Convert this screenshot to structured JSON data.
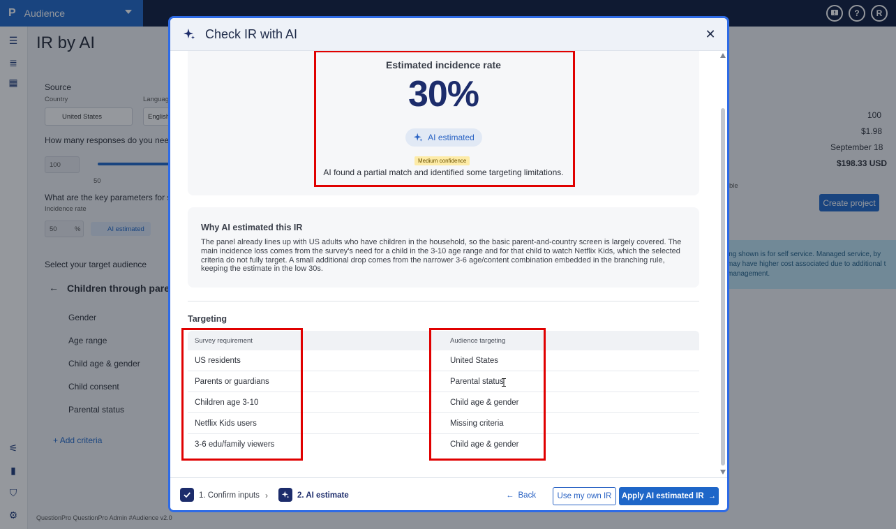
{
  "topbar": {
    "app_logo": "P",
    "app_name": "Audience",
    "icons": [
      "feedback-icon",
      "help-icon"
    ],
    "user_initial": "R"
  },
  "sidenav": {
    "icons": [
      "menu-icon",
      "list-icon",
      "dashboard-icon",
      "settings-sliders-icon",
      "trash-icon",
      "shield-user-icon",
      "gear-icon"
    ]
  },
  "background_page": {
    "title": "IR by AI",
    "source_label": "Source",
    "country_label": "Country",
    "country_value": "United States",
    "language_label": "Languag",
    "language_value": "English",
    "responses_question": "How many responses do you need?",
    "responses_value": "100",
    "slider_min": "50",
    "key_params_question": "What are the key parameters for su",
    "incidence_rate_label": "Incidence rate",
    "incidence_rate_value": "50",
    "percent_sign": "%",
    "ai_estimated_tag": "AI estimated",
    "audience_label": "Select your target audience",
    "audience_title": "Children through pare",
    "criteria": [
      "Gender",
      "Age range",
      "Child age & gender",
      "Child consent",
      "Parental status"
    ],
    "add_criteria": "Add criteria",
    "summary_values": [
      "100",
      "$1.98",
      "September 18",
      "$198.33 USD"
    ],
    "summary_fragment": "ble",
    "create_project": "Create project",
    "info_banner": "ing shown is for self service. Managed service, by may have higher cost associated due to additional t management.",
    "footer_note": "QuestionPro QuestionPro Admin  #Audience v2.0"
  },
  "modal": {
    "title": "Check IR with AI",
    "estimate": {
      "label": "Estimated incidence rate",
      "value": "30%",
      "pill": "AI estimated",
      "confidence": "Medium confidence",
      "note": "AI found a partial match and identified some targeting limitations."
    },
    "why": {
      "title": "Why AI estimated this IR",
      "text": "The panel already lines up with US adults who have children in the household, so the basic parent-and-country screen is largely covered. The main incidence loss comes from the survey's need for a child in the 3-10 age range and for that child to watch Netflix Kids, which the selected criteria do not fully target. A small additional drop comes from the narrower 3-6 age/content combination embedded in the branching rule, keeping the estimate in the low 30s."
    },
    "targeting": {
      "title": "Targeting",
      "columns": [
        "Survey requirement",
        "Audience targeting"
      ],
      "rows": [
        [
          "US residents",
          "United States"
        ],
        [
          "Parents or guardians",
          "Parental status"
        ],
        [
          "Children age 3-10",
          "Child age & gender"
        ],
        [
          "Netflix Kids users",
          "Missing criteria"
        ],
        [
          "3-6 edu/family viewers",
          "Child age & gender"
        ]
      ]
    },
    "footer": {
      "step1": "1. Confirm inputs",
      "step2": "2. AI estimate",
      "back": "Back",
      "own_ir": "Use my own IR",
      "apply": "Apply AI estimated IR"
    }
  },
  "colors": {
    "brand_blue": "#1e66c8",
    "navy": "#1c2c6b",
    "highlight_red": "#e00000",
    "confidence_yellow": "#fdeba7"
  }
}
